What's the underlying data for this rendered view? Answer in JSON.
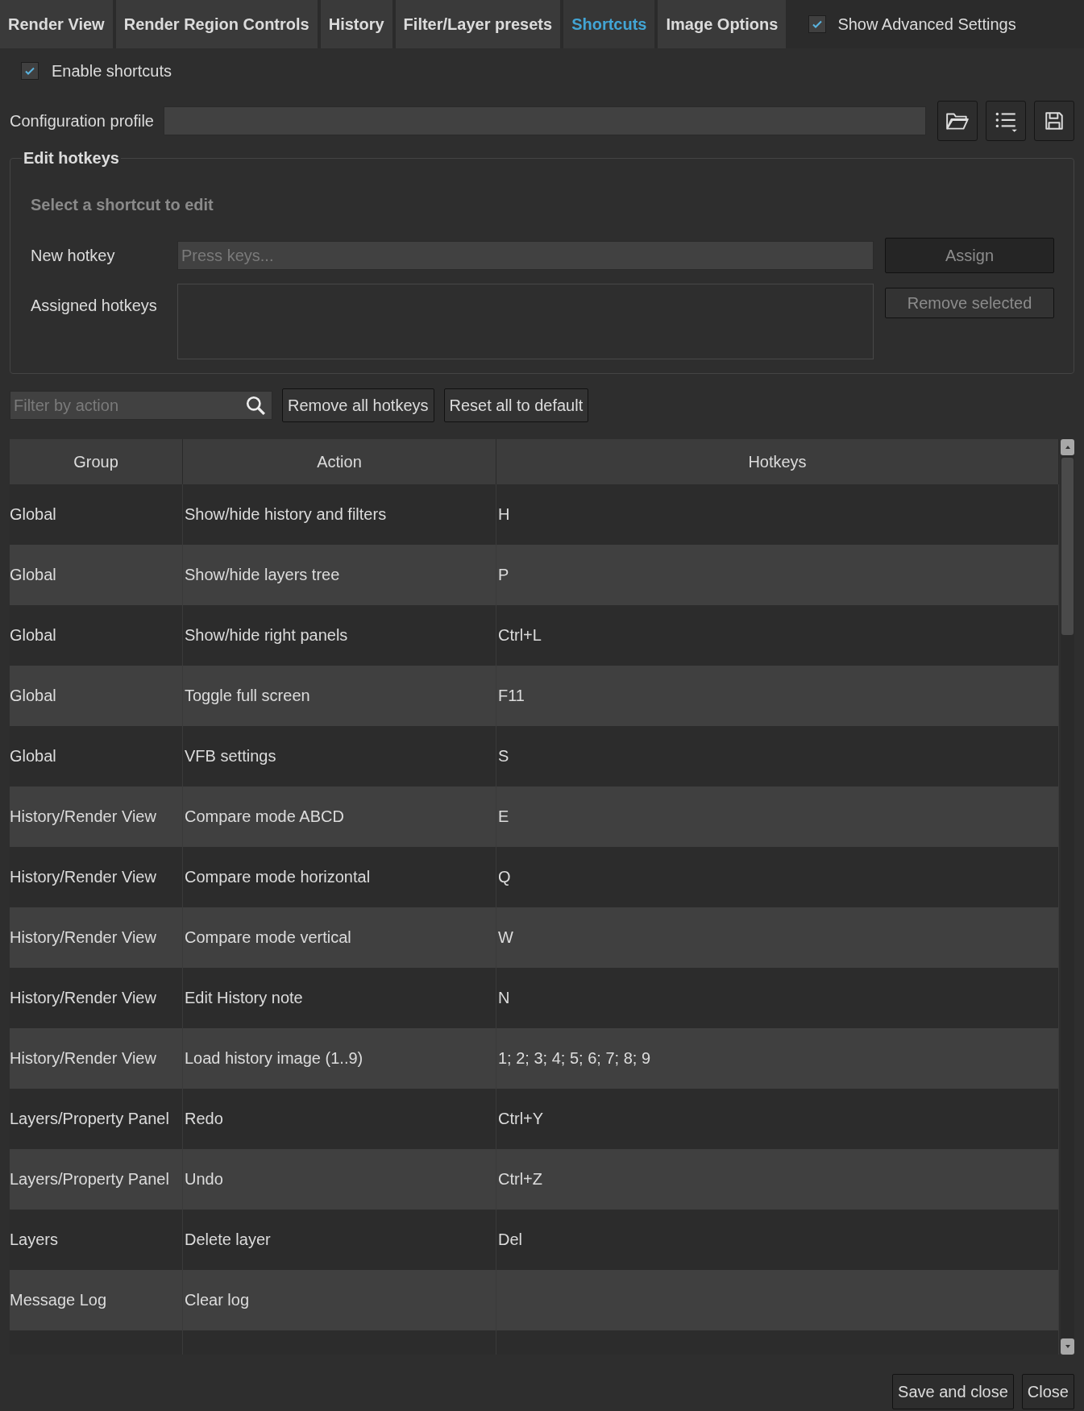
{
  "tabs": [
    {
      "label": "Render View",
      "selected": false
    },
    {
      "label": "Render Region Controls",
      "selected": false
    },
    {
      "label": "History",
      "selected": false
    },
    {
      "label": "Filter/Layer presets",
      "selected": false
    },
    {
      "label": "Shortcuts",
      "selected": true
    },
    {
      "label": "Image Options",
      "selected": false
    }
  ],
  "show_advanced_settings": {
    "label": "Show Advanced Settings",
    "checked": true
  },
  "enable_shortcuts": {
    "label": "Enable shortcuts",
    "checked": true
  },
  "configuration_profile": {
    "label": "Configuration profile"
  },
  "edit_hotkeys": {
    "title": "Edit hotkeys",
    "hint": "Select a shortcut to edit",
    "new_hotkey": {
      "label": "New hotkey",
      "placeholder": "Press keys..."
    },
    "assign_button": {
      "label": "Assign",
      "disabled": true
    },
    "assigned_hotkeys": {
      "label": "Assigned hotkeys"
    },
    "remove_selected_button": {
      "label": "Remove selected",
      "disabled": true
    }
  },
  "filter": {
    "placeholder": "Filter by action"
  },
  "buttons": [
    "Remove all hotkeys",
    "Reset all to default"
  ],
  "table": {
    "columns": [
      "Group",
      "Action",
      "Hotkeys"
    ],
    "rows": [
      [
        "Global",
        "Show/hide history and filters",
        "H"
      ],
      [
        "Global",
        "Show/hide layers tree",
        "P"
      ],
      [
        "Global",
        "Show/hide right panels",
        "Ctrl+L"
      ],
      [
        "Global",
        "Toggle full screen",
        "F11"
      ],
      [
        "Global",
        "VFB settings",
        "S"
      ],
      [
        "History/Render View",
        "Compare mode ABCD",
        "E"
      ],
      [
        "History/Render View",
        "Compare mode horizontal",
        "Q"
      ],
      [
        "History/Render View",
        "Compare mode vertical",
        "W"
      ],
      [
        "History/Render View",
        "Edit History note",
        "N"
      ],
      [
        "History/Render View",
        "Load history image (1..9)",
        "1; 2; 3; 4; 5; 6; 7; 8; 9"
      ],
      [
        "Layers/Property Panel",
        "Redo",
        "Ctrl+Y"
      ],
      [
        "Layers/Property Panel",
        "Undo",
        "Ctrl+Z"
      ],
      [
        "Layers",
        "Delete layer",
        "Del"
      ],
      [
        "Message Log",
        "Clear log",
        ""
      ]
    ]
  },
  "footer_buttons": [
    "Save and close",
    "Close"
  ]
}
